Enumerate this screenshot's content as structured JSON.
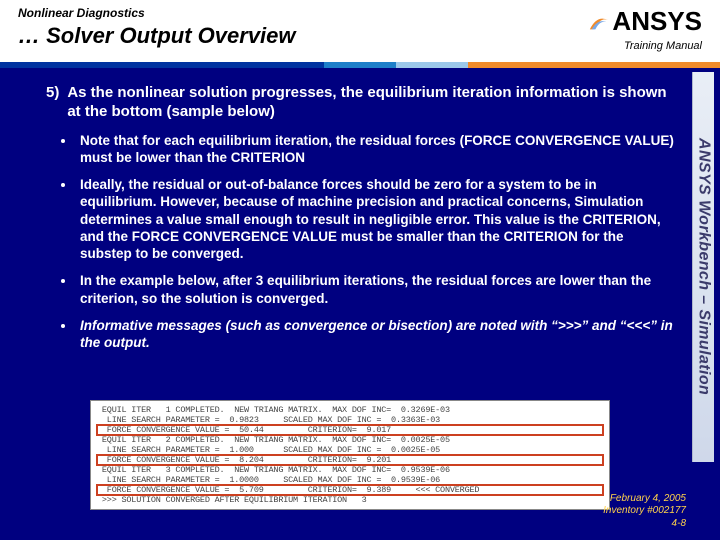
{
  "header": {
    "breadcrumb": "Nonlinear Diagnostics",
    "title": "… Solver Output Overview",
    "training_label": "Training Manual",
    "logo_text": "ANSYS"
  },
  "sidebar_text": "ANSYS Workbench – Simulation",
  "body": {
    "number": "5)",
    "lead": "As the nonlinear solution progresses, the equilibrium iteration information is shown at the bottom (sample below)",
    "bullets": [
      "Note that for each equilibrium iteration, the residual forces (FORCE CONVERGENCE VALUE) must be lower than the CRITERION",
      "Ideally, the residual or out-of-balance forces should be zero for a system to be in equilibrium.  However, because of machine precision and practical concerns, Simulation determines a value small enough to result in negligible error.  This value is the CRITERION, and the FORCE CONVERGENCE VALUE must be smaller than the CRITERION for the substep to be converged.",
      "In the example below, after 3 equilibrium iterations, the residual forces are lower than the criterion, so the solution is converged.",
      "Informative messages (such as convergence or bisection) are noted with “>>>” and “<<<” in the output."
    ]
  },
  "sample": {
    "lines": [
      " EQUIL ITER   1 COMPLETED.  NEW TRIANG MATRIX.  MAX DOF INC=  0.3269E-03",
      "  LINE SEARCH PARAMETER =  0.9823     SCALED MAX DOF INC =  0.3363E-03",
      "  FORCE CONVERGENCE VALUE =  50.44         CRITERION=  9.017",
      " EQUIL ITER   2 COMPLETED.  NEW TRIANG MATRIX.  MAX DOF INC=  0.0025E-05",
      "  LINE SEARCH PARAMETER =  1.000      SCALED MAX DOF INC =  0.0025E-05",
      "  FORCE CONVERGENCE VALUE =  8.204         CRITERION=  9.201",
      " EQUIL ITER   3 COMPLETED.  NEW TRIANG MATRIX.  MAX DOF INC=  0.9539E-06",
      "  LINE SEARCH PARAMETER =  1.0000     SCALED MAX DOF INC =  0.9539E-06",
      "  FORCE CONVERGENCE VALUE =  5.709         CRITERION=  9.389     <<< CONVERGED",
      " >>> SOLUTION CONVERGED AFTER EQUILIBRIUM ITERATION   3"
    ],
    "highlight_rows": [
      2,
      5,
      8
    ]
  },
  "footer": {
    "date": "February 4, 2005",
    "inventory": "Inventory #002177",
    "page": "4-8"
  }
}
